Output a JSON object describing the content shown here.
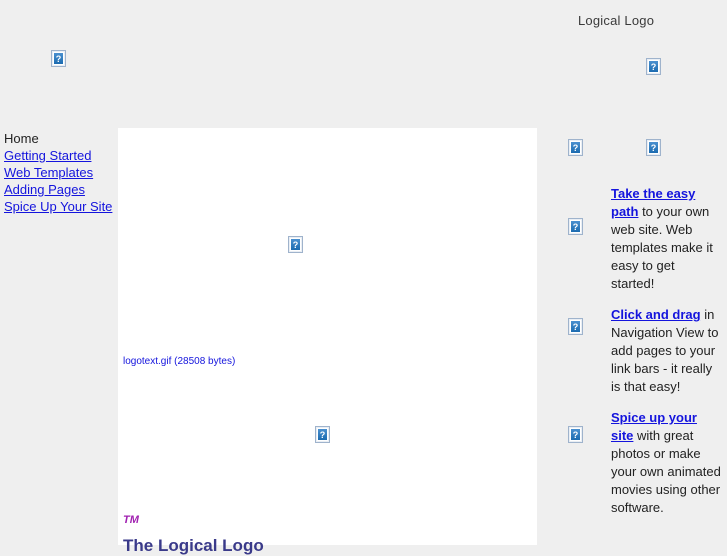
{
  "page": {
    "background_color": "#efefef",
    "panel_color": "#ffffff",
    "link_color": "#1414dd",
    "tm_color": "#a020b0"
  },
  "masthead": {
    "brand_text": "Logical Logo",
    "banner_image": {
      "icon": "broken-image-icon",
      "glyph": "?"
    },
    "logo_image": {
      "icon": "broken-image-icon",
      "glyph": "?"
    }
  },
  "left_nav": {
    "items": [
      {
        "label": "Home",
        "current": true
      },
      {
        "label": "Getting Started",
        "current": false
      },
      {
        "label": "Web Templates",
        "current": false
      },
      {
        "label": "Adding Pages",
        "current": false
      },
      {
        "label": "Spice Up Your Site",
        "current": false
      }
    ]
  },
  "content": {
    "hero_alt_text": "logotext.gif (28508 bytes)",
    "trademark": "TM",
    "headline": "The Logical Logo",
    "middle_image": {
      "icon": "broken-image-icon",
      "glyph": "?"
    },
    "lower_image": {
      "icon": "broken-image-icon",
      "glyph": "?"
    }
  },
  "right_column": {
    "top_image_a": {
      "icon": "broken-image-icon",
      "glyph": "?"
    },
    "top_image_b": {
      "icon": "broken-image-icon",
      "glyph": "?"
    },
    "gutter_image_1": {
      "icon": "broken-image-icon",
      "glyph": "?"
    },
    "gutter_image_2": {
      "icon": "broken-image-icon",
      "glyph": "?"
    },
    "gutter_image_3": {
      "icon": "broken-image-icon",
      "glyph": "?"
    },
    "promos": [
      {
        "link": "Take the easy path",
        "rest": " to your own web site. Web templates make it easy to get started!"
      },
      {
        "link": "Click and drag",
        "rest": " in Navigation View to add pages to your link bars - it really is that easy!"
      },
      {
        "link": "Spice up your site",
        "rest": " with great photos or make your own animated movies using other software."
      }
    ]
  }
}
